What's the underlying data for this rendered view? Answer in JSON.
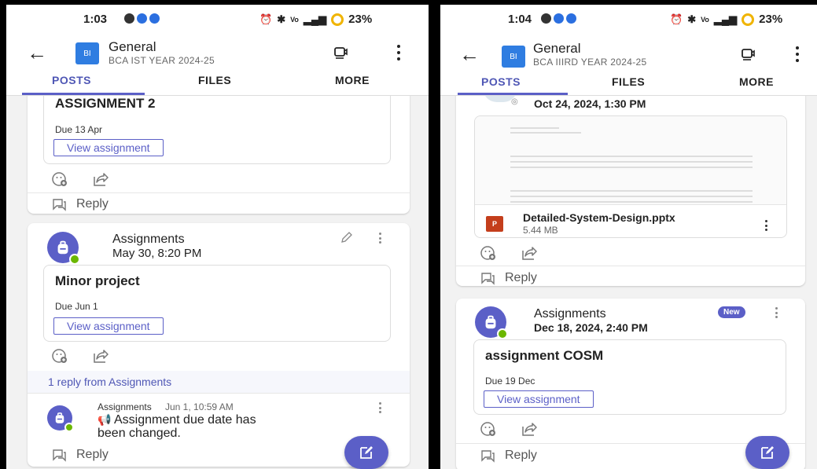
{
  "left": {
    "status": {
      "time": "1:03",
      "battery": "23%"
    },
    "header": {
      "badge": "BI",
      "channel": "General",
      "team": "BCA IST YEAR 2024-25"
    },
    "tabs": {
      "posts": "POSTS",
      "files": "FILES",
      "more": "MORE"
    },
    "card1": {
      "title": "ASSIGNMENT 2",
      "due": "Due 13 Apr",
      "button": "View assignment",
      "reply": "Reply"
    },
    "card2": {
      "author": "Assignments",
      "time": "May 30, 8:20 PM",
      "title": "Minor project",
      "due": "Due Jun 1",
      "button": "View assignment",
      "replies_link": "1 reply from Assignments",
      "reply_author": "Assignments",
      "reply_time": "Jun 1, 10:59 AM",
      "reply_line1": "Assignment due date has",
      "reply_line2": "been changed.",
      "reply": "Reply"
    }
  },
  "right": {
    "status": {
      "time": "1:04",
      "battery": "23%"
    },
    "header": {
      "badge": "BI",
      "channel": "General",
      "team": "BCA IIIRD YEAR 2024-25"
    },
    "tabs": {
      "posts": "POSTS",
      "files": "FILES",
      "more": "MORE"
    },
    "card1": {
      "time": "Oct 24, 2024, 1:30 PM",
      "file_name": "Detailed-System-Design.pptx",
      "file_size": "5.44 MB",
      "reply": "Reply"
    },
    "card2": {
      "author": "Assignments",
      "badge": "New",
      "time": "Dec 18, 2024, 2:40 PM",
      "title": "assignment COSM",
      "due": "Due 19 Dec",
      "button": "View assignment",
      "reply": "Reply"
    }
  },
  "colors": {
    "accent": "#5b5fc7",
    "team_badge": "#2f7de1",
    "presence": "#6bb700",
    "ppt": "#c43e1c"
  }
}
